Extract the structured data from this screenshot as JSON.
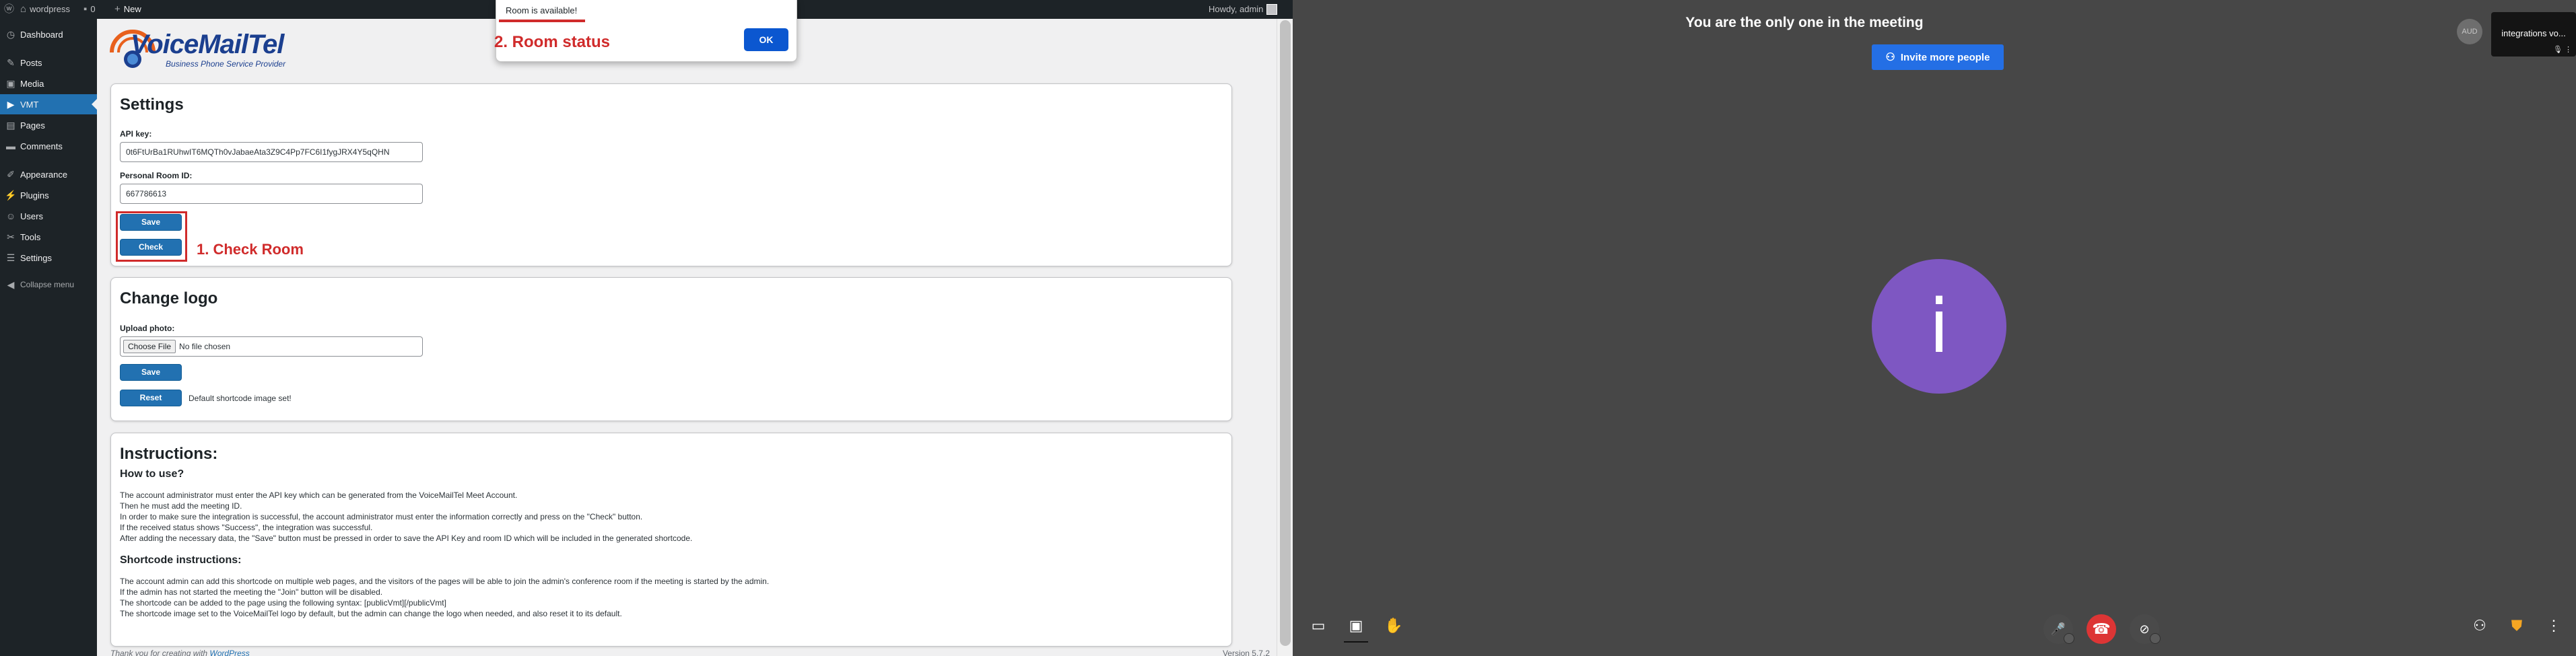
{
  "wp_admin_bar": {
    "site_name": "wordpress",
    "comments_count": "0",
    "new_label": "New",
    "greeting": "Howdy, admin"
  },
  "sidebar": {
    "items": [
      {
        "label": "Dashboard",
        "icon": "dashboard-icon"
      },
      {
        "label": "Posts",
        "icon": "pin-icon"
      },
      {
        "label": "Media",
        "icon": "media-icon"
      },
      {
        "label": "VMT",
        "icon": "video-icon",
        "active": true
      },
      {
        "label": "Pages",
        "icon": "page-icon"
      },
      {
        "label": "Comments",
        "icon": "comment-icon"
      },
      {
        "label": "Appearance",
        "icon": "brush-icon"
      },
      {
        "label": "Plugins",
        "icon": "plug-icon"
      },
      {
        "label": "Users",
        "icon": "user-icon"
      },
      {
        "label": "Tools",
        "icon": "wrench-icon"
      },
      {
        "label": "Settings",
        "icon": "settings-icon"
      }
    ],
    "collapse_label": "Collapse menu"
  },
  "logo": {
    "brand": "VoiceMail",
    "brand_suffix": "Tel",
    "tagline": "Business Phone Service Provider"
  },
  "settings": {
    "title": "Settings",
    "api_key_label": "API key:",
    "api_key_value": "0t6FtUrBa1RUhwIT6MQTh0vJabaeAta3Z9C4Pp7FC6I1fygJRX4Y5qQHN",
    "room_id_label": "Personal Room ID:",
    "room_id_value": "667786613",
    "save_label": "Save",
    "check_label": "Check",
    "annotation": "1. Check Room"
  },
  "change_logo": {
    "title": "Change logo",
    "upload_label": "Upload photo:",
    "choose_file_label": "Choose File",
    "file_status": "No file chosen",
    "save_label": "Save",
    "reset_label": "Reset",
    "reset_note": "Default shortcode image set!"
  },
  "instructions": {
    "title": "Instructions:",
    "how_to_heading": "How to use?",
    "how_to_lines": [
      "The account administrator must enter the API key which can be generated from the VoiceMailTel Meet Account.",
      "Then he must add the meeting ID.",
      "In order to make sure the integration is successful, the account administrator must enter the information correctly and press on the \"Check\" button.",
      "If the received status shows \"Success\", the integration was successful.",
      "After adding the necessary data, the \"Save\" button must be pressed in order to save the API Key and room ID which will be included in the generated shortcode."
    ],
    "shortcode_heading": "Shortcode instructions:",
    "shortcode_lines": [
      "The account admin can add this shortcode on multiple web pages, and the visitors of the pages will be able to join the admin's conference room if the meeting is started by the admin.",
      "If the admin has not started the meeting the \"Join\" button will be disabled.",
      "The shortcode can be added to the page using the following syntax: [publicVmt][/publicVmt]",
      "The shortcode image set to the VoiceMailTel logo by default, but the admin can change the logo when needed, and also reset it to its default."
    ]
  },
  "footer": {
    "thanks_text": "Thank you for creating with ",
    "wp_link": "WordPress",
    "version": "Version 5.7.2"
  },
  "alert": {
    "message": "Room is available!",
    "ok_label": "OK",
    "annotation": "2. Room status"
  },
  "meeting": {
    "title": "You are the only one in the meeting",
    "invite_label": "Invite more people",
    "avatar_letter": "i",
    "small_avatar_text": "AUD",
    "self_tile_name": "integrations vo...",
    "colors": {
      "avatar": "#7e57c2",
      "invite": "#246fe5",
      "hangup": "#dd3535",
      "background": "#474747"
    }
  }
}
